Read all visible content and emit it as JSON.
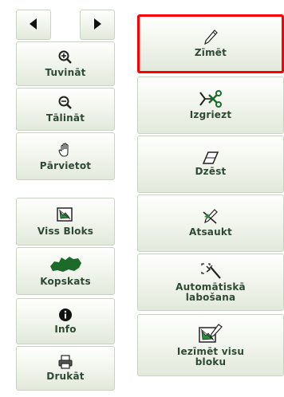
{
  "left_panel": {
    "nav": {
      "back_icon": "triangle-left-icon",
      "forward_icon": "triangle-right-icon"
    },
    "buttons": [
      {
        "label": "Tuvināt",
        "icon": "zoom-in-icon"
      },
      {
        "label": "Tālināt",
        "icon": "zoom-out-icon"
      },
      {
        "label": "Pārvietot",
        "icon": "hand-icon"
      },
      {
        "label": "Viss Bloks",
        "icon": "whole-block-icon"
      },
      {
        "label": "Kopskats",
        "icon": "latvia-map-icon"
      },
      {
        "label": "Info",
        "icon": "info-icon"
      },
      {
        "label": "Drukāt",
        "icon": "printer-icon"
      }
    ]
  },
  "right_panel": {
    "buttons": [
      {
        "label": "Zīmēt",
        "icon": "pencil-icon",
        "selected": true
      },
      {
        "label": "Izgriezt",
        "icon": "scissors-icon"
      },
      {
        "label": "Dzēst",
        "icon": "eraser-icon"
      },
      {
        "label": "Atsaukt",
        "icon": "undo-draw-icon"
      },
      {
        "label": "Automātiskā labošana",
        "icon": "auto-fix-icon"
      },
      {
        "label": "Iezīmēt visu bloku",
        "icon": "select-block-icon"
      }
    ]
  },
  "colors": {
    "text": "#2e4a33",
    "selection": "#ff0000",
    "border": "#c9d3c3"
  }
}
